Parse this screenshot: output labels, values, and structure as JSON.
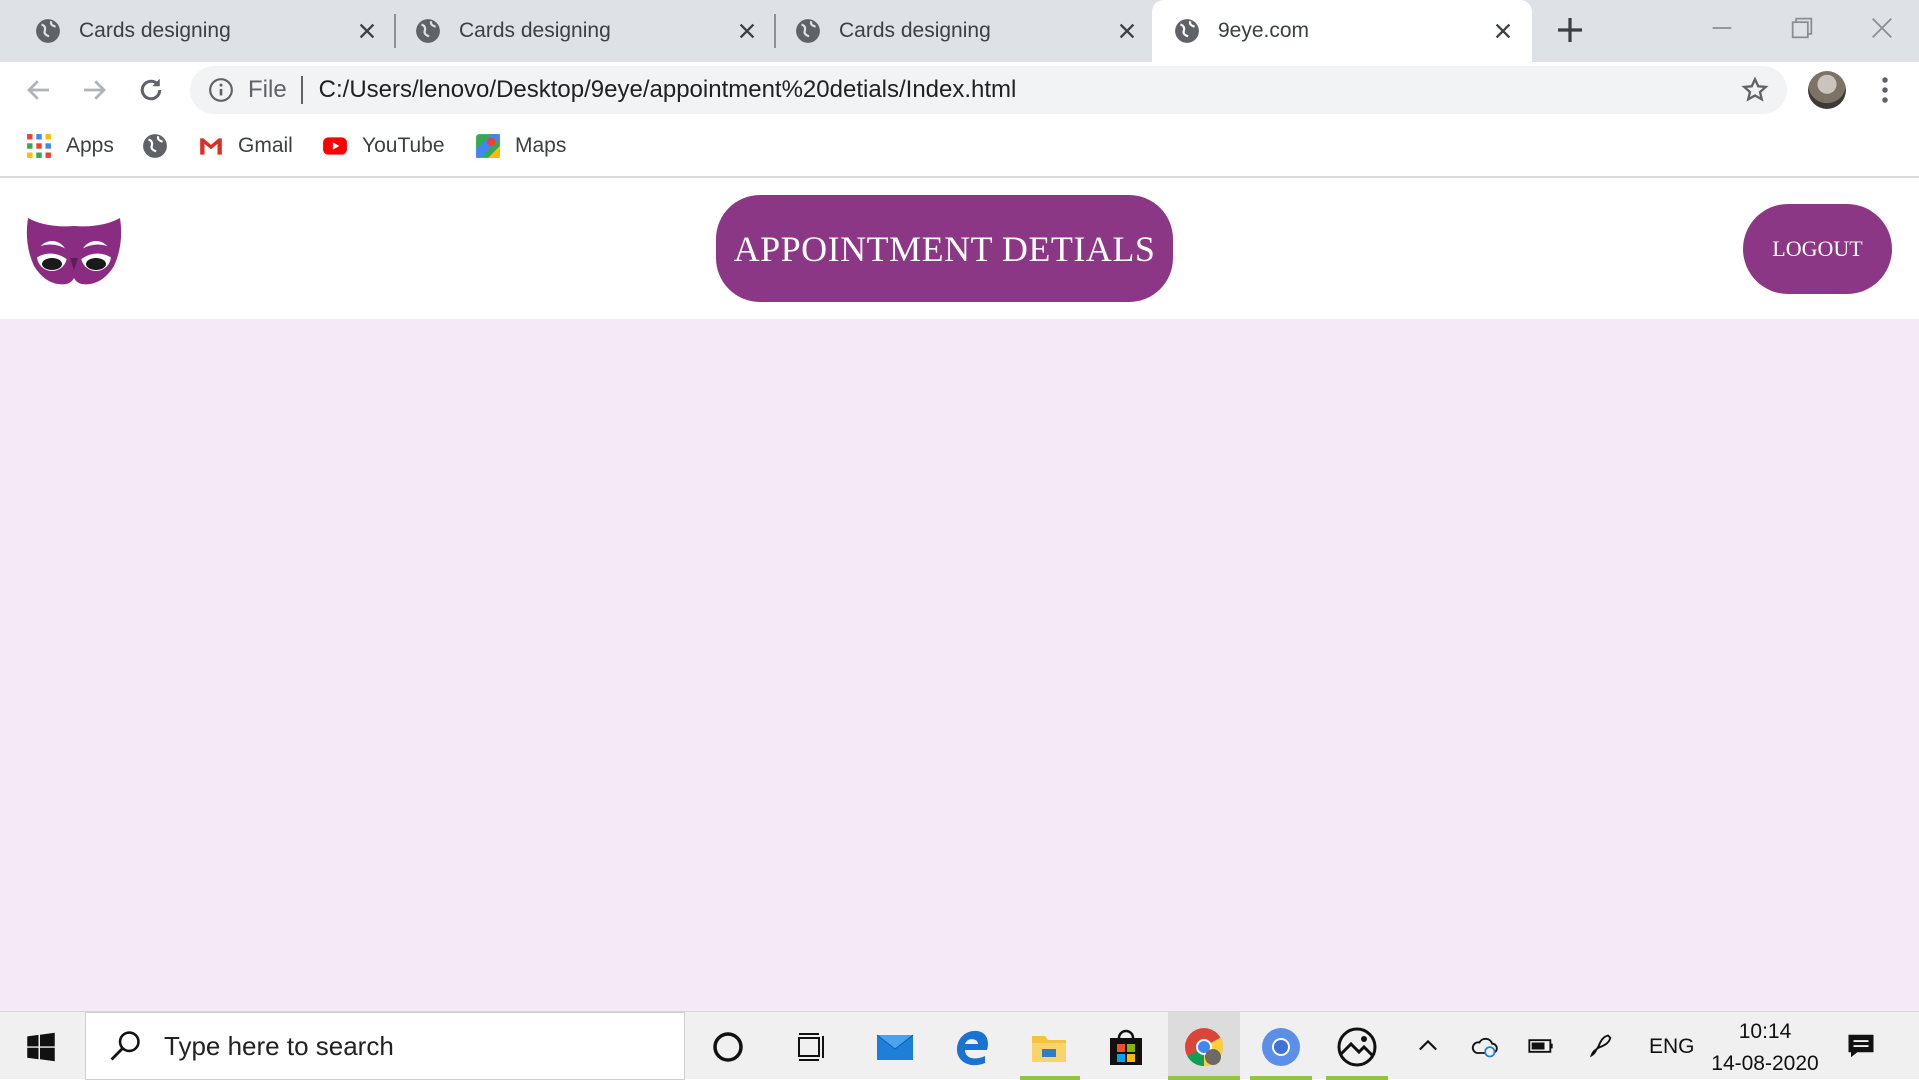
{
  "browser": {
    "tabs": [
      {
        "title": "Cards designing",
        "active": false
      },
      {
        "title": "Cards designing",
        "active": false
      },
      {
        "title": "Cards designing",
        "active": false
      },
      {
        "title": "9eye.com",
        "active": true
      }
    ],
    "address": {
      "scheme_label": "File",
      "url": "C:/Users/lenovo/Desktop/9eye/appointment%20detials/Index.html"
    },
    "bookmarks": [
      {
        "label": "Apps",
        "icon": "apps-grid-icon"
      },
      {
        "label": "",
        "icon": "globe-icon"
      },
      {
        "label": "Gmail",
        "icon": "gmail-icon"
      },
      {
        "label": "YouTube",
        "icon": "youtube-icon"
      },
      {
        "label": "Maps",
        "icon": "maps-icon"
      }
    ]
  },
  "page": {
    "header": {
      "title": "APPOINTMENT DETIALS",
      "logout_label": "LOGOUT"
    },
    "colors": {
      "brand": "#8b3785",
      "background": "#f6e9f7"
    }
  },
  "taskbar": {
    "search_placeholder": "Type here to search",
    "language": "ENG",
    "time": "10:14",
    "date": "14-08-2020"
  }
}
